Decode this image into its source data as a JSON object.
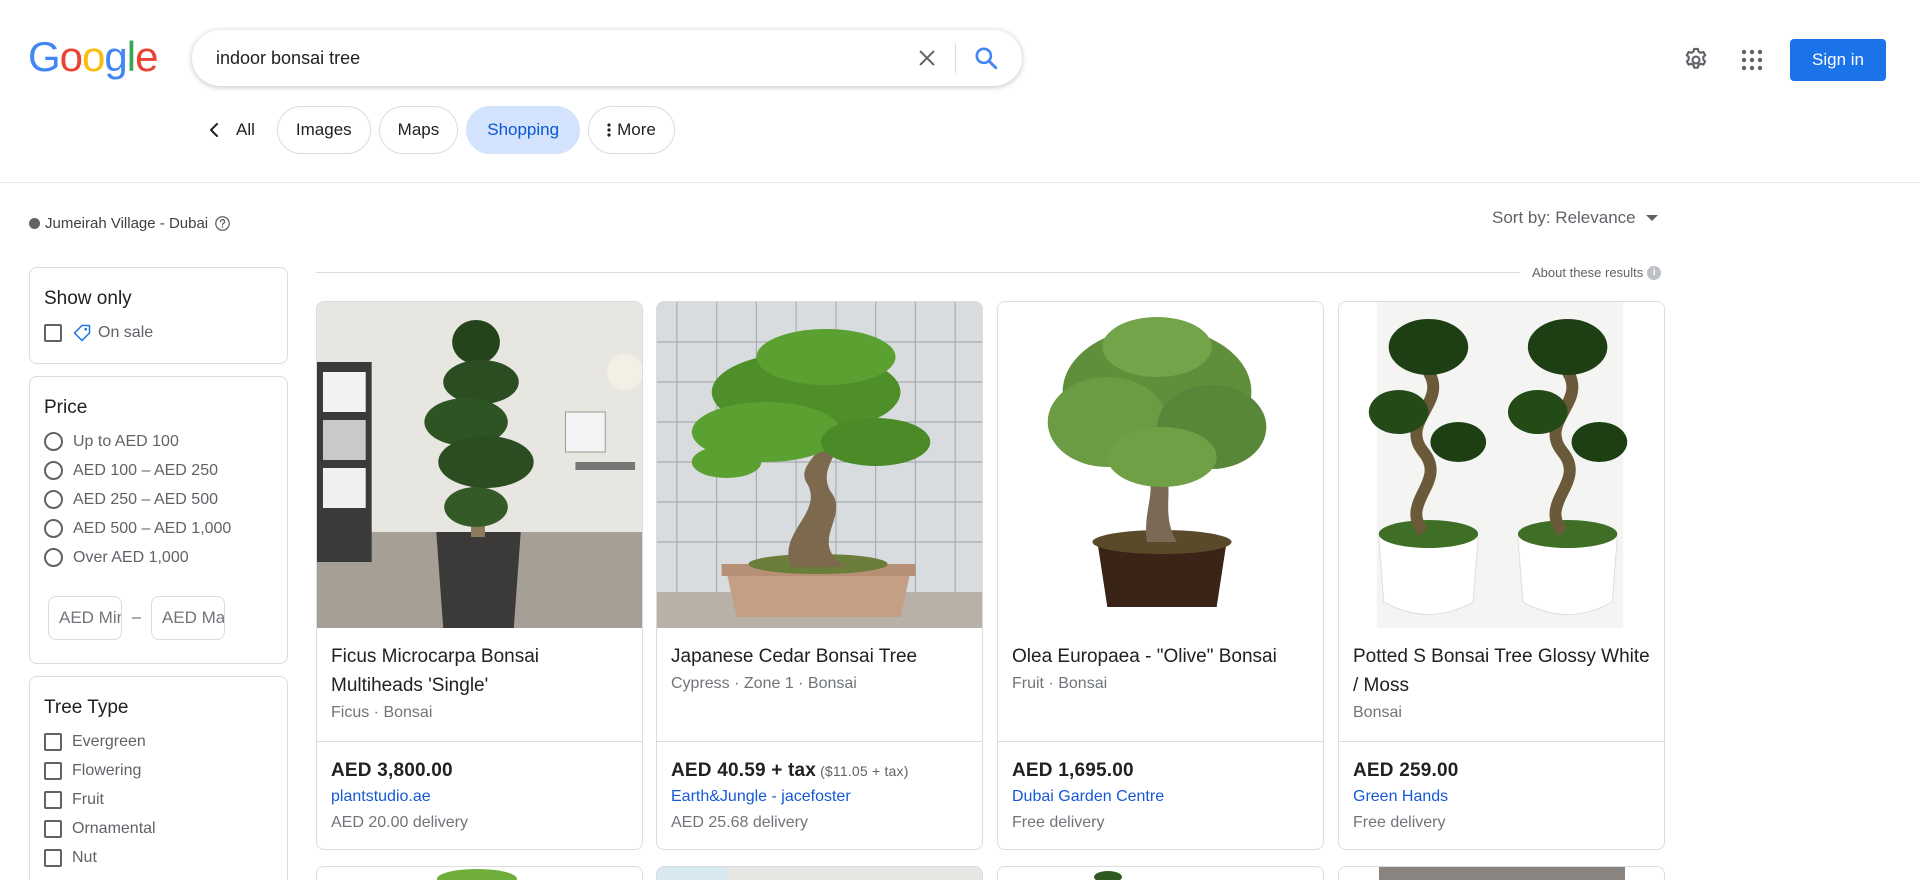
{
  "logo": {
    "letters": [
      "G",
      "o",
      "o",
      "g",
      "l",
      "e"
    ],
    "colors": [
      "#4285F4",
      "#EA4335",
      "#FBBC05",
      "#4285F4",
      "#34A853",
      "#EA4335"
    ]
  },
  "search": {
    "value": "indoor bonsai tree"
  },
  "header": {
    "sign_in": "Sign in"
  },
  "tabs": {
    "all": "All",
    "items": [
      "Images",
      "Maps",
      "Shopping",
      "More"
    ],
    "active": "Shopping"
  },
  "location": {
    "text": "Jumeirah Village - Dubai"
  },
  "sort": {
    "label": "Sort by: Relevance"
  },
  "about": {
    "label": "About these results"
  },
  "filters": {
    "show_only": {
      "title": "Show only",
      "options": [
        "On sale"
      ]
    },
    "price": {
      "title": "Price",
      "options": [
        "Up to AED 100",
        "AED 100 – AED 250",
        "AED 250 – AED 500",
        "AED 500 – AED 1,000",
        "Over AED 1,000"
      ],
      "min_placeholder": "AED Min",
      "max_placeholder": "AED Max",
      "dash": "–"
    },
    "tree_type": {
      "title": "Tree Type",
      "options": [
        "Evergreen",
        "Flowering",
        "Fruit",
        "Ornamental",
        "Nut"
      ]
    }
  },
  "products": [
    {
      "title": "Ficus Microcarpa Bonsai Multiheads 'Single'",
      "meta": "Ficus · Bonsai",
      "price": "AED 3,800.00",
      "tax": "",
      "seller": "plantstudio.ae",
      "delivery": "AED 20.00 delivery"
    },
    {
      "title": "Japanese Cedar Bonsai Tree",
      "meta": "Cypress · Zone 1 · Bonsai",
      "price": "AED 40.59 + tax",
      "tax": "($11.05 + tax)",
      "seller": "Earth&Jungle - jacefoster",
      "delivery": "AED 25.68 delivery"
    },
    {
      "title": "Olea Europaea - \"Olive\" Bonsai",
      "meta": "Fruit · Bonsai",
      "price": "AED 1,695.00",
      "tax": "",
      "seller": "Dubai Garden Centre",
      "delivery": "Free delivery"
    },
    {
      "title": "Potted S Bonsai Tree Glossy White / Moss",
      "meta": "Bonsai",
      "price": "AED 259.00",
      "tax": "",
      "seller": "Green Hands",
      "delivery": "Free delivery"
    }
  ]
}
